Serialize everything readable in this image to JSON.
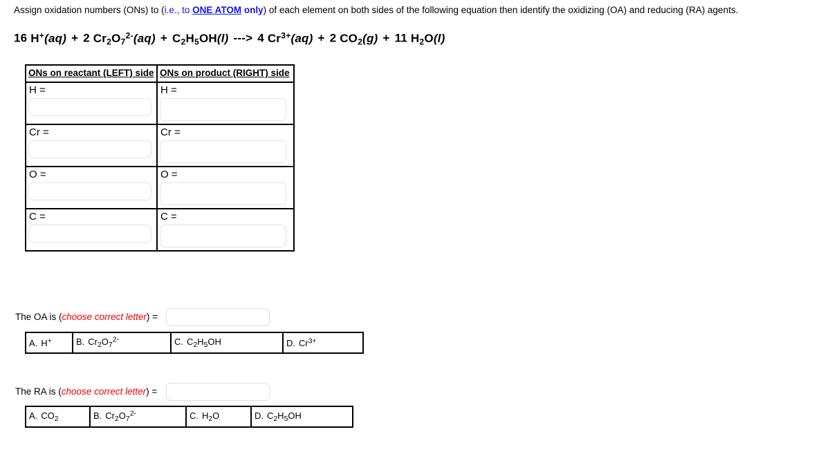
{
  "instructions": {
    "part1": "Assign oxidation numbers (ONs) to (",
    "blue1": "i.e., to ",
    "blue_bold": "ONE ATOM",
    "blue2": " only",
    "part2": ") of each element on both sides of the following equation then identify the oxidizing (OA) and reducing (RA) agents."
  },
  "equation": {
    "text": "16 H+(aq) + 2 Cr2O7 2-(aq) + C2H5OH(l) ---> 4 Cr3+(aq) + 2 CO2(g) + 11 H2O(l)",
    "terms": {
      "c_h": "16",
      "h": "H",
      "h_charge": "+",
      "h_state": "(aq)",
      "plus": "+",
      "c_dichromate": "2",
      "cr_sym": "Cr",
      "cr_sub": "2",
      "o_sym": "O",
      "o_sub": "7",
      "dichromate_charge": "2-",
      "dichromate_state": "(aq)",
      "eth_c": "C",
      "eth_c_sub": "2",
      "eth_h": "H",
      "eth_h_sub": "5",
      "eth_oh": "OH",
      "eth_state": "(l)",
      "arrow": "--->",
      "c_cr3": "4",
      "cr3_sym": "Cr",
      "cr3_charge": "3+",
      "cr3_state": "(aq)",
      "c_co2": "2",
      "co2_sym": "CO",
      "co2_sub": "2",
      "co2_state": "(g)",
      "c_water": "11",
      "water_h": "H",
      "water_sub": "2",
      "water_o": "O",
      "water_state": "(l)"
    }
  },
  "on_table": {
    "headers": {
      "left": "ONs on reactant (LEFT) side",
      "right": "ONs on product (RIGHT) side"
    },
    "rows": [
      {
        "left_label": "H =",
        "right_label": "H =",
        "left_value": "",
        "right_value": ""
      },
      {
        "left_label": "Cr =",
        "right_label": "Cr =",
        "left_value": "",
        "right_value": ""
      },
      {
        "left_label": "O =",
        "right_label": "O =",
        "left_value": "",
        "right_value": ""
      },
      {
        "left_label": "C =",
        "right_label": "C =",
        "left_value": "",
        "right_value": ""
      }
    ]
  },
  "oa_question": {
    "prefix": "The OA is (",
    "emphasis": "choose correct letter",
    "suffix": ") =",
    "answer_value": "",
    "choices": [
      {
        "letter": "A.",
        "formula_html": "H+",
        "sym": "H",
        "sup": "+",
        "sub": ""
      },
      {
        "letter": "B.",
        "formula_html": "Cr2O7 2-",
        "sym": "Cr",
        "sub1": "2",
        "sym2": "O",
        "sub2": "7",
        "sup": "2-"
      },
      {
        "letter": "C.",
        "formula_html": "C2H5OH",
        "sym": "C",
        "sub1": "2",
        "sym2": "H",
        "sub2": "5",
        "tail": "OH"
      },
      {
        "letter": "D.",
        "formula_html": "Cr3+",
        "sym": "Cr",
        "sup": "3+",
        "sub": ""
      }
    ]
  },
  "ra_question": {
    "prefix": "The RA is (",
    "emphasis": "choose correct letter",
    "suffix": ") =",
    "answer_value": "",
    "choices": [
      {
        "letter": "A.",
        "formula_html": "CO2",
        "sym": "CO",
        "sub1": "2"
      },
      {
        "letter": "B.",
        "formula_html": "Cr2O7 2-",
        "sym": "Cr",
        "sub1": "2",
        "sym2": "O",
        "sub2": "7",
        "sup": "2-"
      },
      {
        "letter": "C.",
        "formula_html": "H2O",
        "sym": "H",
        "sub1": "2",
        "tail": "O"
      },
      {
        "letter": "D.",
        "formula_html": "C2H5OH",
        "sym": "C",
        "sub1": "2",
        "sym2": "H",
        "sub2": "5",
        "tail": "OH"
      }
    ]
  },
  "colors": {
    "blue": "#1414e6",
    "red": "#ee0000",
    "border": "#000000",
    "input_border": "#e3e3e3"
  }
}
